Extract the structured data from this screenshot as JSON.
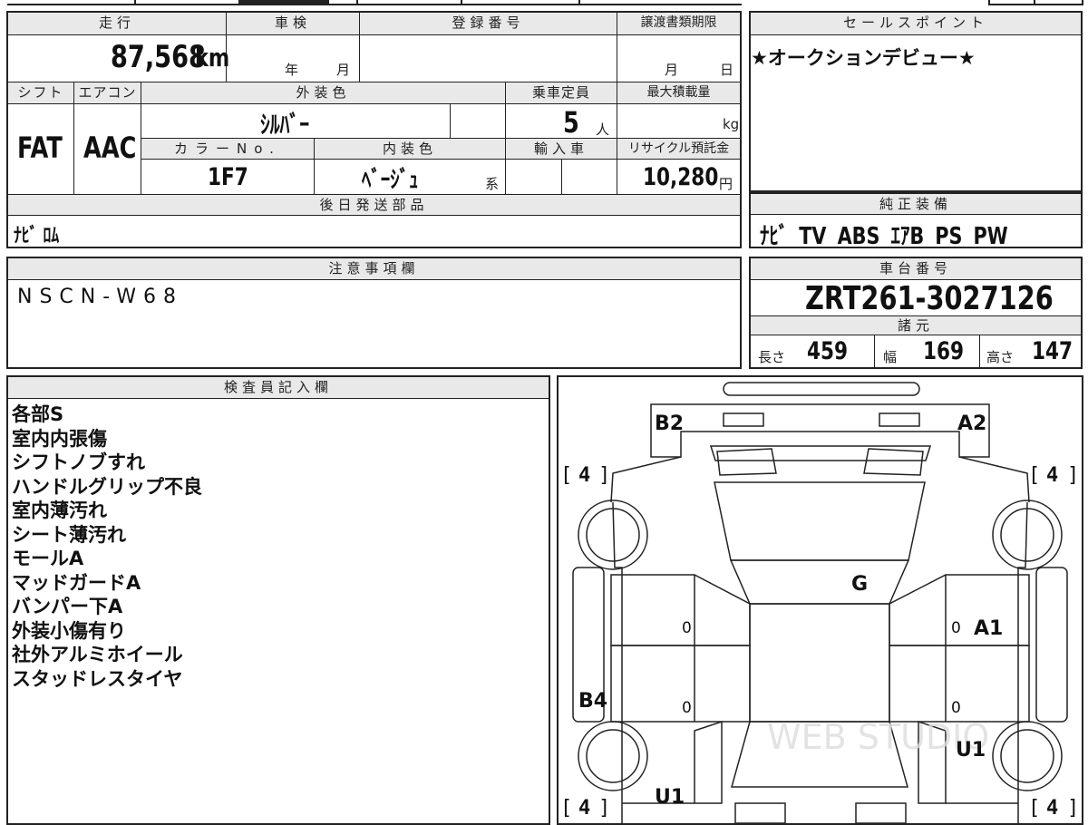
{
  "mileage": {
    "label": "走行",
    "value": "87,568",
    "unit": "km"
  },
  "inspection": {
    "label": "車検",
    "year_unit": "年",
    "month_unit": "月"
  },
  "registration": {
    "label": "登録番号"
  },
  "deadline": {
    "label": "譲渡書類期限",
    "month_unit": "月",
    "day_unit": "日"
  },
  "sales_point": {
    "label": "セールスポイント",
    "text": "★オークションデビュー★"
  },
  "shift": {
    "label": "シフト",
    "value": "FAT"
  },
  "aircon": {
    "label": "エアコン",
    "value": "AAC"
  },
  "exterior_color": {
    "label": "外装色",
    "value": "ｼﾙﾊﾞｰ"
  },
  "capacity": {
    "label": "乗車定員",
    "value": "5",
    "unit": "人"
  },
  "max_load": {
    "label": "最大積載量",
    "unit": "kg"
  },
  "color_no": {
    "label": "カラーNo.",
    "value": "1F7"
  },
  "interior_color": {
    "label": "内装色",
    "value": "ﾍﾞｰｼﾞｭ",
    "suffix": "系"
  },
  "import_car": {
    "label": "輸入車"
  },
  "recycle": {
    "label": "リサイクル預託金",
    "value": "10,280",
    "unit": "円"
  },
  "later_parts": {
    "label": "後日発送部品",
    "value": "ﾅﾋﾞ ﾛﾑ"
  },
  "genuine_equipment": {
    "label": "純正装備",
    "value": "ﾅﾋﾞ TV ABS ｴｱB PS PW"
  },
  "notes": {
    "label": "注意事項欄",
    "value": "NSCN-W68"
  },
  "chassis": {
    "label": "車台番号",
    "value": "ZRT261-3027126"
  },
  "specs": {
    "label": "諸元",
    "length_label": "長さ",
    "length": "459",
    "width_label": "幅",
    "width": "169",
    "height_label": "高さ",
    "height": "147"
  },
  "inspector": {
    "label": "検査員記入欄",
    "remarks": [
      "各部S",
      "室内内張傷",
      "シフトノブすれ",
      "ハンドルグリップ不良",
      "室内薄汚れ",
      "シート薄汚れ",
      "モールA",
      "マッドガードA",
      "バンパー下A",
      "外装小傷有り",
      "社外アルミホイール",
      "スタッドレスタイヤ"
    ]
  },
  "diagram": {
    "marks": {
      "b2": "B2",
      "a2": "A2",
      "g": "G",
      "a1": "A1",
      "b4": "B4",
      "u1_right": "U1",
      "u1_bottom": "U1"
    },
    "tires": {
      "front_left": "4",
      "front_right": "4",
      "rear_left": "4",
      "rear_right": "4"
    },
    "zeros": [
      "0",
      "0",
      "0",
      "0"
    ],
    "watermark": "WEB STUDIO"
  }
}
